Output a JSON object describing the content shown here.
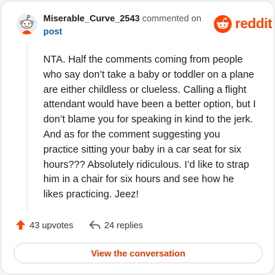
{
  "header": {
    "username": "Miserable_Curve_2543",
    "action_text": "commented on",
    "target_link": "post",
    "brand_name": "reddit"
  },
  "comment": {
    "body": "NTA. Half the comments coming from people who say don’t take a baby or toddler on a plane are either childless or clueless. Calling a flight attendant would have been a better option, but I don’t blame you for speaking in kind to the jerk. And as for the comment suggesting you practice sitting your baby in a car seat for six hours??? Absolutely ridiculous. I’d like to strap him in a chair for six hours and see how he likes practicing. Jeez!"
  },
  "stats": {
    "upvotes": "43 upvotes",
    "replies": "24 replies"
  },
  "actions": {
    "view_label": "View the conversation"
  },
  "icons": {
    "avatar": "snoo-avatar-icon",
    "brand": "reddit-logo-icon",
    "upvote": "upvote-arrow-icon",
    "reply": "reply-arrow-icon"
  },
  "colors": {
    "brand": "#ff4500",
    "link": "#0f5fa6",
    "button_text": "#d93a00"
  }
}
